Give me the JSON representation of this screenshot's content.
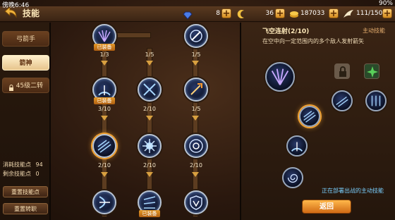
{
  "status_bar": {
    "time": "傍晚6:46",
    "battery": "90%"
  },
  "header": {
    "title": "技能",
    "back_icon": "back-arrow-icon"
  },
  "resources": {
    "gems": "8",
    "coins": "36",
    "gold": "187033",
    "stamina": "111/150"
  },
  "left_tabs": [
    {
      "label": "弓箭手"
    },
    {
      "label": "箭神"
    },
    {
      "label": "45级二转"
    }
  ],
  "stats": {
    "consumed_label": "消耗技能点",
    "consumed_value": "94",
    "remaining_label": "剩余技能点",
    "remaining_value": "0"
  },
  "buttons": {
    "reset_points": "重置技能点",
    "reset_class": "重置转职",
    "back": "返回"
  },
  "tree": {
    "equipped_tag": "已装备",
    "levels": [
      "1/3",
      "1/5",
      "1/5",
      "3/10",
      "2/10",
      "1/5",
      "2/10",
      "2/10",
      "2/10"
    ]
  },
  "detail": {
    "name": "飞空连射(2/10)",
    "type": "主动技能",
    "description": "在空中向一定范围内的多个敌人发射箭矢",
    "deploy_note": "正在部署出战的主动技能"
  },
  "colors": {
    "accent": "#e69a28",
    "link": "#7ad0ff",
    "panel": "#3a2414"
  }
}
